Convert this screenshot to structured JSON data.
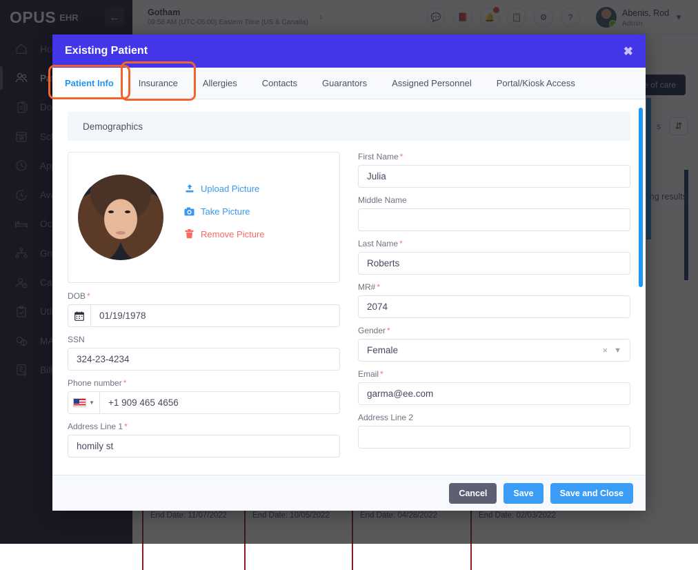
{
  "app": {
    "logo_main": "OPUS",
    "logo_sub": "EHR",
    "collapse_icon": "arrow-left-icon"
  },
  "topbar": {
    "facility_name": "Gotham",
    "facility_time": "09:58 AM (UTC-05:00) Eastern Time (US & Canada)",
    "facility_caret": "↕",
    "icons": [
      {
        "name": "chat-icon",
        "glyph": "💬",
        "badge": false
      },
      {
        "name": "book-icon",
        "glyph": "📕",
        "badge": false
      },
      {
        "name": "bell-icon",
        "glyph": "🔔",
        "badge": true
      },
      {
        "name": "clipboard-icon",
        "glyph": "📋",
        "badge": false
      },
      {
        "name": "gear-icon",
        "glyph": "⚙",
        "badge": false
      },
      {
        "name": "help-icon",
        "glyph": "?",
        "badge": false
      }
    ],
    "user_name": "Abenis, Rod",
    "user_role": "Admin",
    "user_caret": "⌄"
  },
  "sidebar": {
    "items": [
      {
        "label": "Home",
        "icon": "home-icon",
        "active": false
      },
      {
        "label": "Patients",
        "icon": "patients-icon",
        "active": true
      },
      {
        "label": "Documents",
        "icon": "documents-icon",
        "active": false
      },
      {
        "label": "Scheduling",
        "icon": "calendar-icon",
        "active": false
      },
      {
        "label": "Appointments",
        "icon": "clock-icon",
        "active": false
      },
      {
        "label": "Availability",
        "icon": "availability-clock-icon",
        "active": false
      },
      {
        "label": "Occupancy",
        "icon": "bed-icon",
        "active": false
      },
      {
        "label": "Groups",
        "icon": "groups-icon",
        "active": false
      },
      {
        "label": "Caseload",
        "icon": "caseload-user-icon",
        "active": false
      },
      {
        "label": "Utilization",
        "icon": "checklist-icon",
        "active": false
      },
      {
        "label": "MAR",
        "icon": "pills-icon",
        "active": false
      },
      {
        "label": "Billing",
        "icon": "billing-icon",
        "active": false
      }
    ]
  },
  "background": {
    "tab_button": "de of care",
    "select_value": "s",
    "sort_icon": "sort-icon",
    "results_text": "ng results",
    "cards": [
      {
        "date_label": "End Date: 11/07/2022"
      },
      {
        "date_label": "End Date: 10/05/2022"
      },
      {
        "date_label": "End Date: 04/28/2022"
      },
      {
        "date_label": "End Date: 02/03/2022"
      }
    ]
  },
  "modal": {
    "title": "Existing Patient",
    "close_icon": "close-icon",
    "tabs": [
      {
        "label": "Patient Info",
        "active": true,
        "highlighted": true
      },
      {
        "label": "Insurance",
        "active": false,
        "highlighted": true
      },
      {
        "label": "Allergies",
        "active": false,
        "highlighted": false
      },
      {
        "label": "Contacts",
        "active": false,
        "highlighted": false
      },
      {
        "label": "Guarantors",
        "active": false,
        "highlighted": false
      },
      {
        "label": "Assigned Personnel",
        "active": false,
        "highlighted": false
      },
      {
        "label": "Portal/Kiosk Access",
        "active": false,
        "highlighted": false
      }
    ],
    "section_title": "Demographics",
    "photo_actions": [
      {
        "label": "Upload Picture",
        "icon": "upload-icon",
        "tone": "link"
      },
      {
        "label": "Take Picture",
        "icon": "camera-icon",
        "tone": "link"
      },
      {
        "label": "Remove Picture",
        "icon": "trash-icon",
        "tone": "danger"
      }
    ],
    "fields": {
      "dob": {
        "label": "DOB",
        "required": true,
        "value": "01/19/1978",
        "placeholder": "",
        "prefix_icon": "calendar-icon"
      },
      "ssn": {
        "label": "SSN",
        "required": false,
        "value": "324-23-4234",
        "placeholder": ""
      },
      "phone": {
        "label": "Phone number",
        "required": true,
        "value": "+1 909 465 4656",
        "placeholder": "",
        "country": "US"
      },
      "address1": {
        "label": "Address Line 1",
        "required": true,
        "value": "homily st",
        "placeholder": ""
      },
      "first_name": {
        "label": "First Name",
        "required": true,
        "value": "Julia",
        "placeholder": ""
      },
      "middle_name": {
        "label": "Middle Name",
        "required": false,
        "value": "",
        "placeholder": ""
      },
      "last_name": {
        "label": "Last Name",
        "required": true,
        "value": "Roberts",
        "placeholder": ""
      },
      "mrn": {
        "label": "MR#",
        "required": true,
        "value": "2074",
        "placeholder": ""
      },
      "gender": {
        "label": "Gender",
        "required": true,
        "value": "Female",
        "placeholder": "",
        "clear_icon": "×",
        "chevron_icon": "⌄"
      },
      "email": {
        "label": "Email",
        "required": true,
        "value": "garma@ee.com",
        "placeholder": ""
      },
      "address2": {
        "label": "Address Line 2",
        "required": false,
        "value": "",
        "placeholder": ""
      }
    },
    "footer": {
      "cancel": "Cancel",
      "save": "Save",
      "save_and_close": "Save and Close"
    }
  },
  "colors": {
    "modal_header": "#4336E8",
    "accent_blue": "#2196F3",
    "highlight_orange": "#F4642A",
    "sidebar_bg": "#1B1C3A",
    "required_red": "#F5776D",
    "danger": "#FA6A5F"
  }
}
